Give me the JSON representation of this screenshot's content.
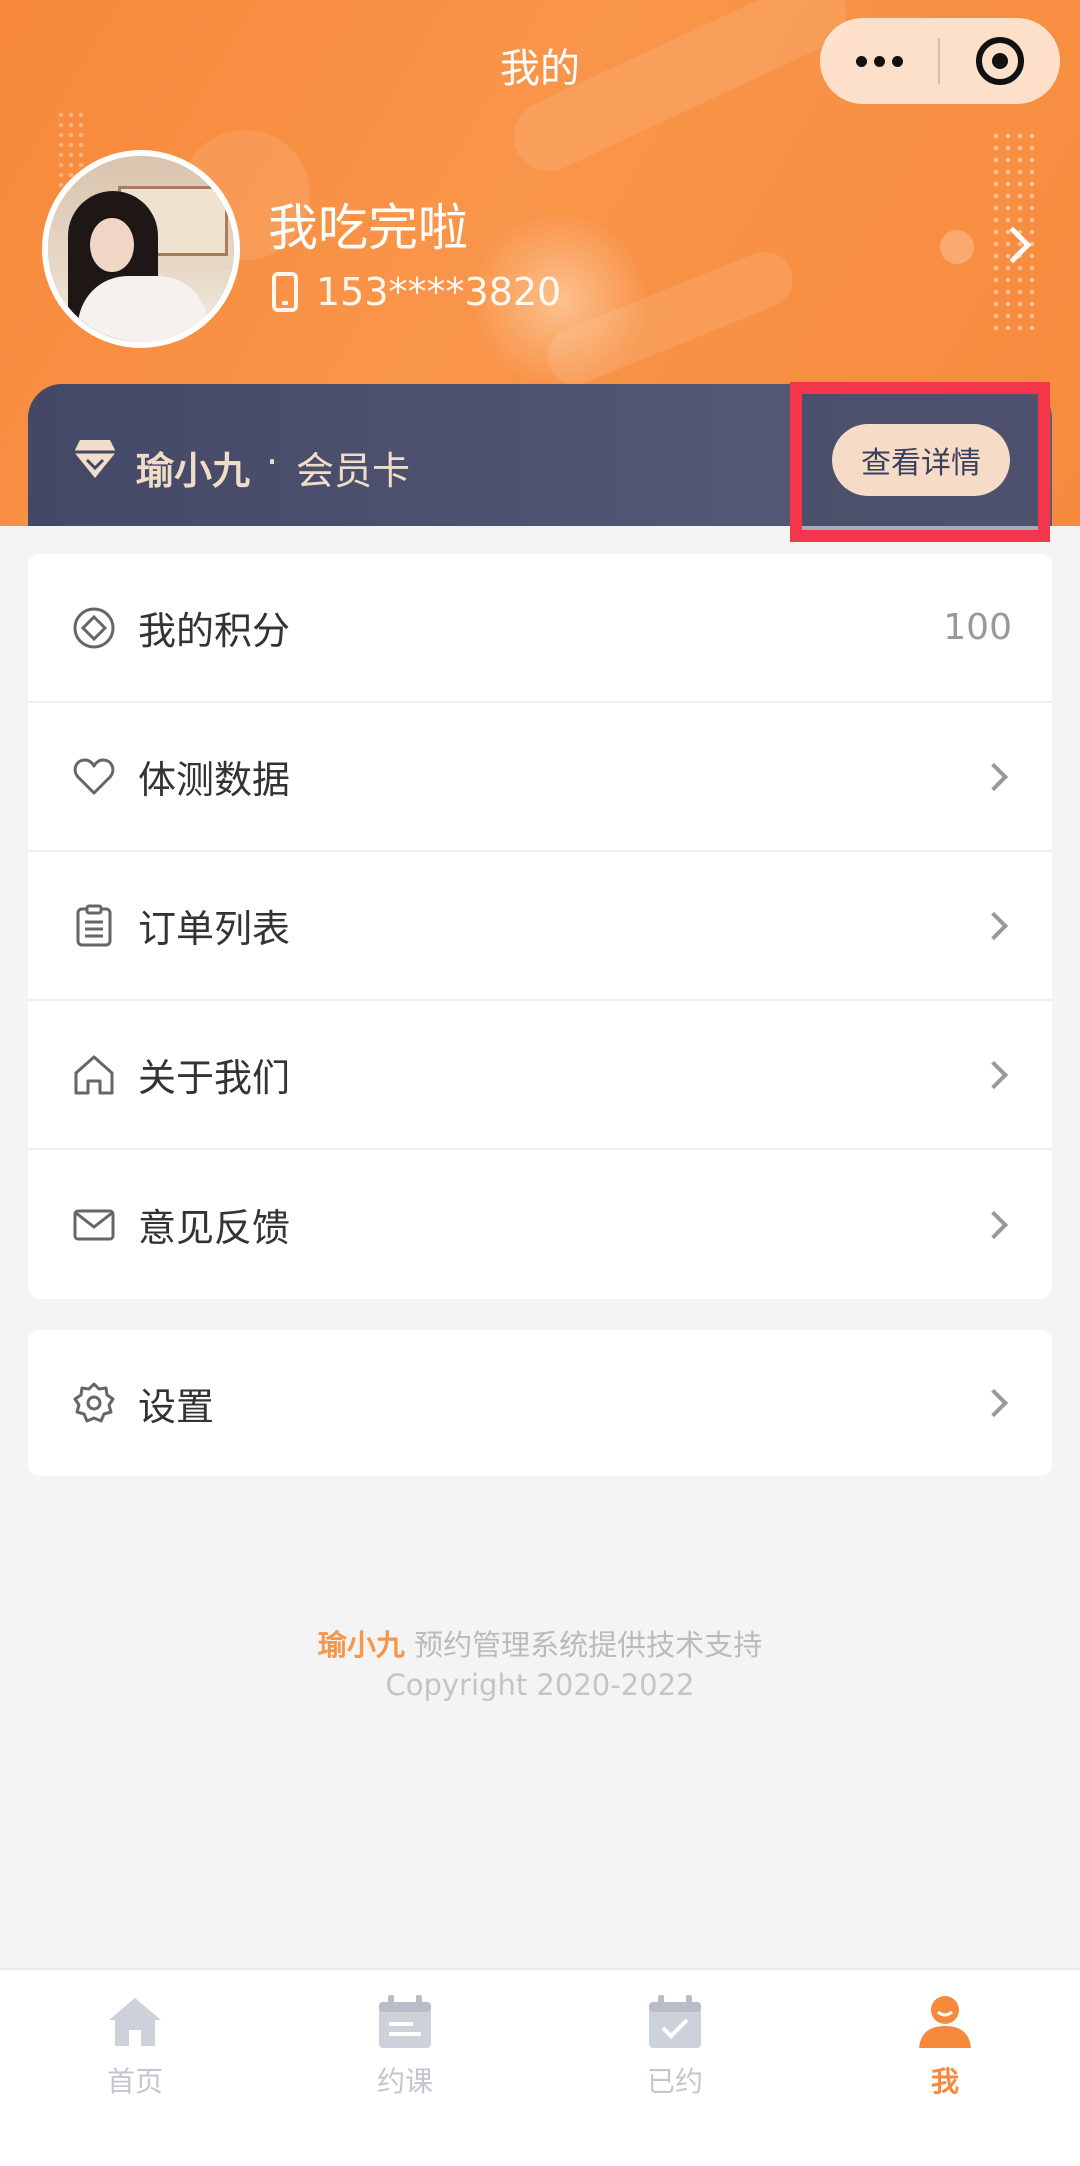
{
  "header": {
    "title": "我的",
    "capsule": {
      "more_icon": "ellipsis-icon",
      "close_icon": "target-icon"
    }
  },
  "profile": {
    "name": "我吃完啦",
    "phone": "153****3820",
    "phone_icon": "mobile-phone-icon"
  },
  "member_card": {
    "brand": "瑜小九",
    "separator": "·",
    "label": "会员卡",
    "details_button": "查看详情",
    "gem_icon": "diamond-icon"
  },
  "menu": {
    "items": [
      {
        "label": "我的积分",
        "value": "100",
        "icon": "points-icon"
      },
      {
        "label": "体测数据",
        "icon": "heart-icon"
      },
      {
        "label": "订单列表",
        "icon": "clipboard-list-icon"
      },
      {
        "label": "关于我们",
        "icon": "home-icon"
      },
      {
        "label": "意见反馈",
        "icon": "mail-icon"
      }
    ],
    "settings": {
      "label": "设置",
      "icon": "gear-icon"
    }
  },
  "footer": {
    "brand": "瑜小九",
    "support_text": " 预约管理系统提供技术支持",
    "copyright": "Copyright 2020-2022"
  },
  "tabbar": {
    "items": [
      {
        "label": "首页",
        "icon": "home-icon",
        "active": false
      },
      {
        "label": "约课",
        "icon": "calendar-icon",
        "active": false
      },
      {
        "label": "已约",
        "icon": "calendar-check-icon",
        "active": false
      },
      {
        "label": "我",
        "icon": "user-icon",
        "active": true
      }
    ]
  },
  "colors": {
    "accent": "#f7893d",
    "card_dark": "#434866",
    "highlight": "#f4354a",
    "button_bg": "#f6dcc6"
  }
}
